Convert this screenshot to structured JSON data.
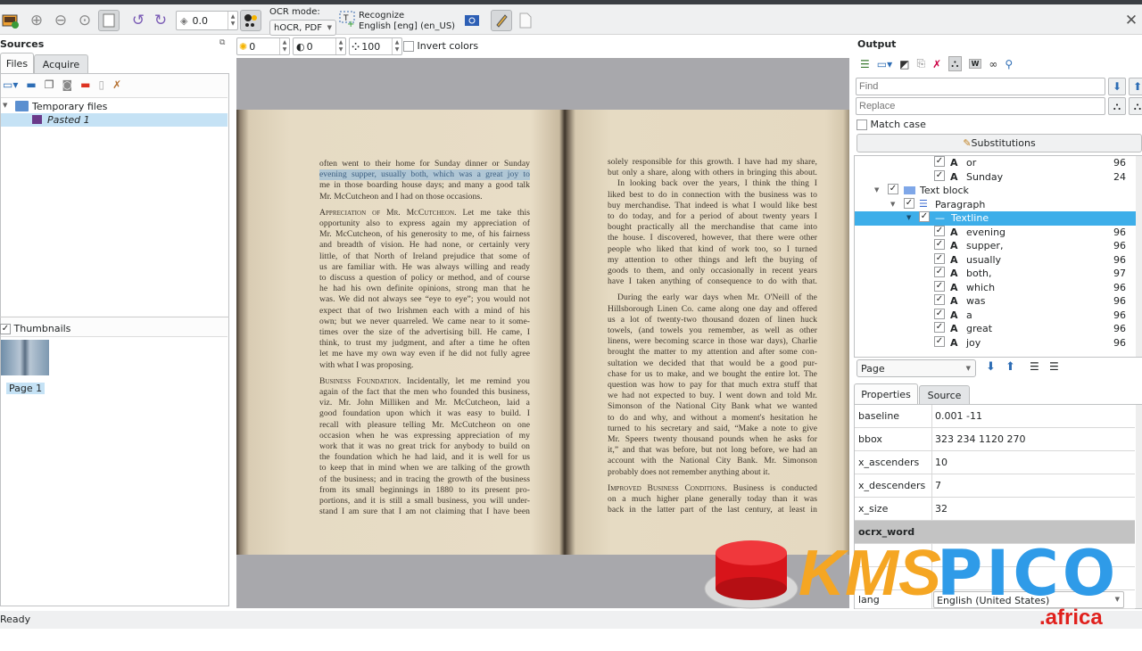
{
  "toolbar": {
    "rotation_value": "0.0",
    "ocr_mode_label": "OCR mode:",
    "ocr_mode_value": "hOCR, PDF",
    "recognize_label": "Recognize",
    "recognize_language": "English [eng] (en_US)"
  },
  "image_controls": {
    "brightness": "0",
    "contrast": "0",
    "resolution": "100",
    "invert_label": "Invert colors"
  },
  "sources": {
    "title": "Sources",
    "tabs": [
      "Files",
      "Acquire"
    ],
    "tree": {
      "folder": "Temporary files",
      "item": "Pasted 1"
    },
    "thumbnails_label": "Thumbnails",
    "thumbnail_page": "Page 1"
  },
  "document": {
    "left_page": [
      {
        "t": "often went to their home for Sunday dinner or Sunday"
      },
      {
        "t": "evening supper, usually both, which was a great joy to",
        "hl": true
      },
      {
        "t": "me in those boarding house days; and many a good talk"
      },
      {
        "t": "Mr. McCutcheon and I had on those occasions.",
        "last": true
      },
      {
        "sc": "Appreciation of Mr. McCutcheon.",
        "t": " Let me take this"
      },
      {
        "t": "opportunity also to express again my appreciation of"
      },
      {
        "t": "Mr. McCutcheon, of his generosity to me, of his fairness"
      },
      {
        "t": "and breadth of vision. He had none, or certainly very"
      },
      {
        "t": "little, of that North of Ireland prejudice that some of"
      },
      {
        "t": "us are familiar with. He was always willing and ready"
      },
      {
        "t": "to discuss a question of policy or method, and of course"
      },
      {
        "t": "he had his own definite opinions, strong man that he"
      },
      {
        "t": "was. We did not always see “eye to eye”; you would not"
      },
      {
        "t": "expect that of two Irishmen each with a mind of his"
      },
      {
        "t": "own; but we never quarreled. We came near to it some-"
      },
      {
        "t": "times over the size of the advertising bill. He came, I"
      },
      {
        "t": "think, to trust my judgment, and after a time he often"
      },
      {
        "t": "let me have my own way even if he did not fully agree"
      },
      {
        "t": "with what I was proposing.",
        "last": true
      },
      {
        "sc": "Business Foundation.",
        "t": " Incidentally, let me remind you"
      },
      {
        "t": "again of the fact that the men who founded this business,"
      },
      {
        "t": "viz. Mr. John Milliken and Mr. McCutcheon, laid a"
      },
      {
        "t": "good foundation upon which it was easy to build. I"
      },
      {
        "t": "recall with pleasure telling Mr. McCutcheon on one"
      },
      {
        "t": "occasion when he was expressing appreciation of my"
      },
      {
        "t": "work that it was no great trick for anybody to build on"
      },
      {
        "t": "the foundation which he had laid, and it is well for us"
      },
      {
        "t": "to keep that in mind when we are talking of the growth"
      },
      {
        "t": "of the business; and in tracing the growth of the business"
      },
      {
        "t": "from its small beginnings in 1880 to its present pro-"
      },
      {
        "t": "portions, and it is still a small business, you will under-"
      },
      {
        "t": "stand I am sure that I am not claiming that I have been"
      }
    ],
    "right_page": [
      {
        "t": "solely responsible for this growth. I have had my share,"
      },
      {
        "t": "but only a share, along with others in bringing this about."
      },
      {
        "t": "In looking back over the years, I think the thing I",
        "indent": true
      },
      {
        "t": "liked best to do in connection with the business was to"
      },
      {
        "t": "buy merchandise. That indeed is what I would like best"
      },
      {
        "t": "to do today, and for a period of about twenty years I"
      },
      {
        "t": "bought practically all the merchandise that came into"
      },
      {
        "t": "the house. I discovered, however, that there were other"
      },
      {
        "t": "people who liked that kind of work too, so I turned"
      },
      {
        "t": "my attention to other things and left the buying of"
      },
      {
        "t": "goods to them, and only occasionally in recent years"
      },
      {
        "t": "have I taken anything of consequence to do with that."
      },
      {
        "t": "During the early war days when Mr. O'Neill of the",
        "indent": true
      },
      {
        "t": "Hillsborough Linen Co. came along one day and offered"
      },
      {
        "t": "us a lot of twenty-two thousand dozen of linen huck"
      },
      {
        "t": "towels, (and towels you remember, as well as other"
      },
      {
        "t": "linens, were becoming scarce in those war days), Charlie"
      },
      {
        "t": "brought the matter to my attention and after some con-"
      },
      {
        "t": "sultation we decided that that would be a good pur-"
      },
      {
        "t": "chase for us to make, and we bought the entire lot. The"
      },
      {
        "t": "question was how to pay for that much extra stuff that"
      },
      {
        "t": "we had not expected to buy. I went down and told Mr."
      },
      {
        "t": "Simonson of the National City Bank what we wanted"
      },
      {
        "t": "to do and why, and without a moment's hesitation he"
      },
      {
        "t": "turned to his secretary and said, “Make a note to give"
      },
      {
        "t": "Mr. Speers twenty thousand pounds when he asks for"
      },
      {
        "t": "it,” and that was before, but not long before, we had an"
      },
      {
        "t": "account with the National City Bank. Mr. Simonson"
      },
      {
        "t": "probably does not remember anything about it.",
        "last": true
      },
      {
        "sc": "Improved Business Conditions.",
        "t": " Business is conducted"
      },
      {
        "t": "on a much higher plane generally today than it was"
      },
      {
        "t": "back in the latter part of the last century, at least in"
      }
    ]
  },
  "output": {
    "title": "Output",
    "find_placeholder": "Find",
    "replace_placeholder": "Replace",
    "match_case_label": "Match case",
    "substitutions_label": "Substitutions",
    "tree_top_words": [
      {
        "word": "or",
        "conf": "96"
      },
      {
        "word": "Sunday",
        "conf": "24"
      }
    ],
    "text_block_label": "Text block",
    "paragraph_label": "Paragraph",
    "textline_label": "Textline",
    "textline_words": [
      {
        "word": "evening",
        "conf": "96"
      },
      {
        "word": "supper,",
        "conf": "96"
      },
      {
        "word": "usually",
        "conf": "96"
      },
      {
        "word": "both,",
        "conf": "97"
      },
      {
        "word": "which",
        "conf": "96"
      },
      {
        "word": "was",
        "conf": "96"
      },
      {
        "word": "a",
        "conf": "96"
      },
      {
        "word": "great",
        "conf": "96"
      },
      {
        "word": "joy",
        "conf": "96"
      }
    ],
    "navigate_select": "Page",
    "prop_tabs": [
      "Properties",
      "Source"
    ],
    "properties": [
      {
        "key": "baseline",
        "value": "0.001 -11"
      },
      {
        "key": "bbox",
        "value": "323 234 1120 270"
      },
      {
        "key": "x_ascenders",
        "value": "10"
      },
      {
        "key": "x_descenders",
        "value": "7"
      },
      {
        "key": "x_size",
        "value": "32"
      }
    ],
    "word_section": "ocrx_word",
    "lang_key": "lang",
    "lang_value": "English (United States)"
  },
  "status": {
    "text": "Ready"
  },
  "watermark": {
    "brand_a": "KMS",
    "brand_b": "PICO",
    "domain": ".africa",
    "colors": {
      "orange": "#f5a623",
      "blue": "#2f9be8",
      "red": "#e0201c"
    }
  },
  "colors": {
    "selection": "#3daee9",
    "tree_highlight": "#c5e2f5"
  }
}
